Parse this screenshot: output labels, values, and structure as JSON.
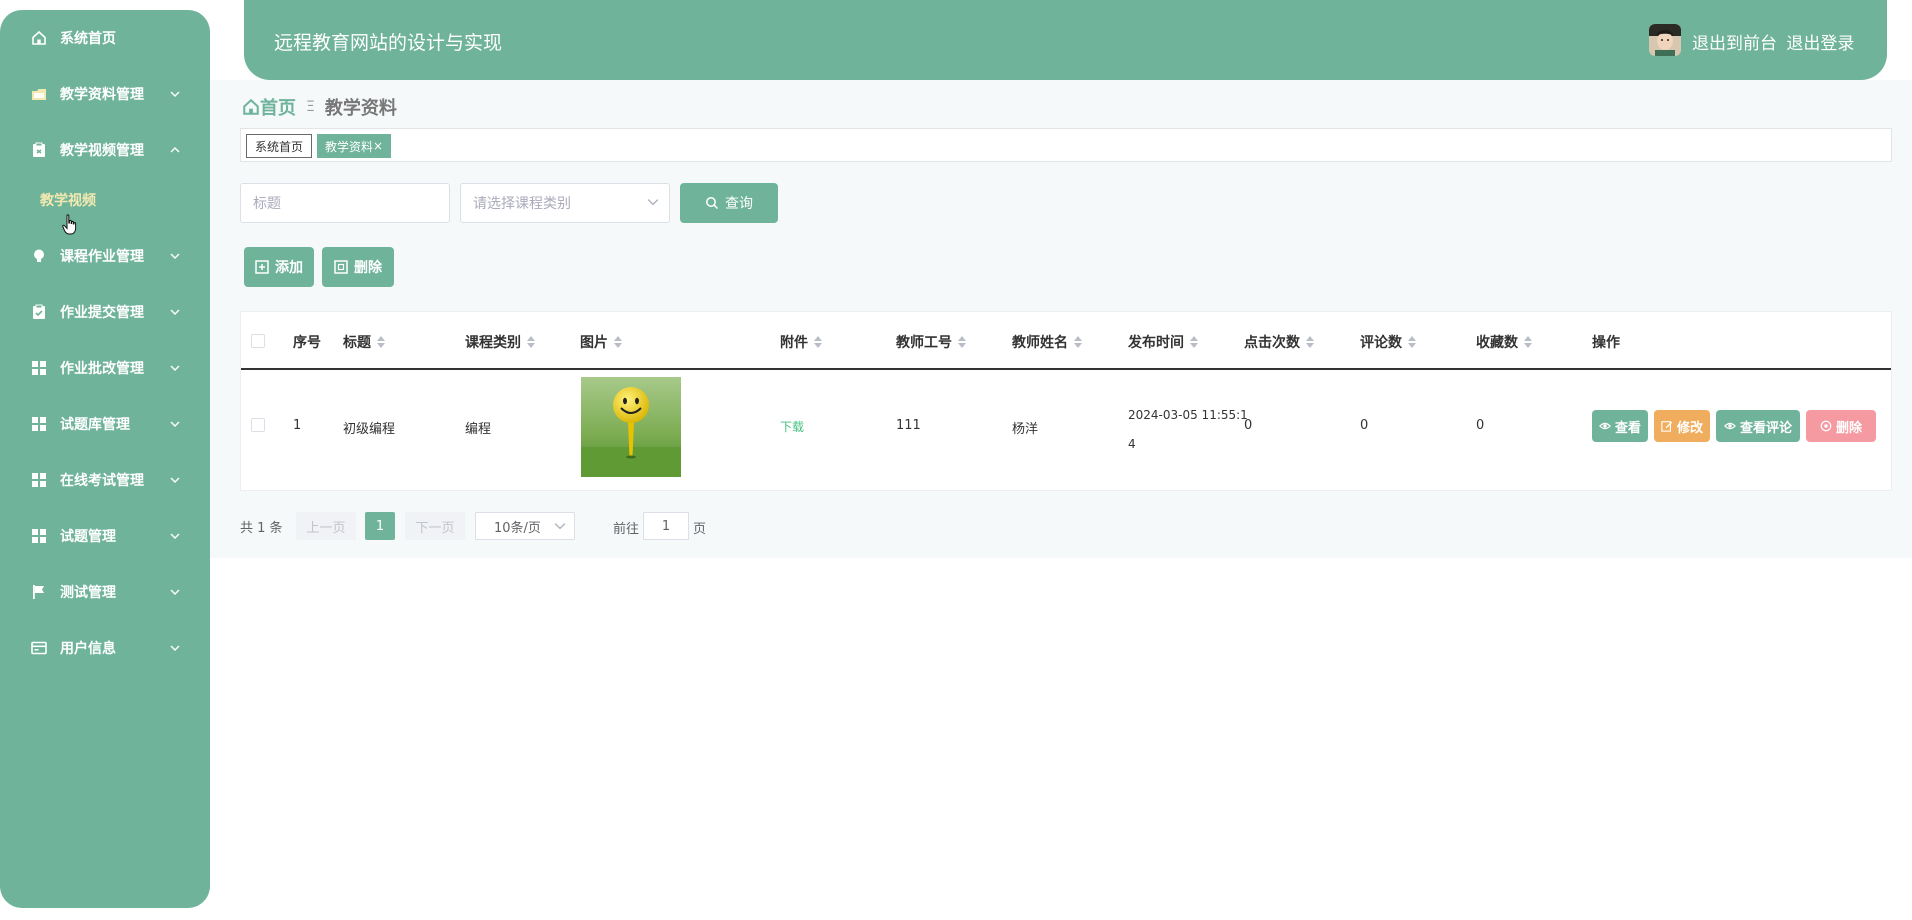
{
  "header": {
    "title": "远程教育网站的设计与实现",
    "link_front": "退出到前台",
    "link_logout": "退出登录"
  },
  "sidebar": {
    "items": [
      {
        "label": "系统首页",
        "icon": "home-icon"
      },
      {
        "label": "教学资料管理",
        "icon": "folder-icon"
      },
      {
        "label": "教学视频管理",
        "icon": "clipboard-icon"
      },
      {
        "label": "课程作业管理",
        "icon": "bulb-icon"
      },
      {
        "label": "作业提交管理",
        "icon": "clipboard-check-icon"
      },
      {
        "label": "作业批改管理",
        "icon": "grid-icon"
      },
      {
        "label": "试题库管理",
        "icon": "grid-icon"
      },
      {
        "label": "在线考试管理",
        "icon": "grid-icon"
      },
      {
        "label": "试题管理",
        "icon": "grid-icon"
      },
      {
        "label": "测试管理",
        "icon": "flag-icon"
      },
      {
        "label": "用户信息",
        "icon": "card-icon"
      }
    ],
    "sub_item": "教学视频"
  },
  "breadcrumb": {
    "home": "首页",
    "current": "教学资料"
  },
  "tags": {
    "tag1": "系统首页",
    "tag2": "教学资料",
    "tag2_close": "×"
  },
  "search": {
    "title_placeholder": "标题",
    "category_placeholder": "请选择课程类别",
    "query_label": "查询"
  },
  "actions": {
    "add_label": "添加",
    "delete_label": "删除"
  },
  "table": {
    "columns": [
      "序号",
      "标题",
      "课程类别",
      "图片",
      "附件",
      "教师工号",
      "教师姓名",
      "发布时间",
      "点击次数",
      "评论数",
      "收藏数",
      "操作"
    ],
    "rows": [
      {
        "index": "1",
        "title": "初级编程",
        "category": "编程",
        "attachment": "下载",
        "teacher_id": "111",
        "teacher_name": "杨洋",
        "publish_time_line1": "2024-03-05 11:55:1",
        "publish_time_line2": "4",
        "clicks": "0",
        "comments": "0",
        "favorites": "0",
        "op_view": "查看",
        "op_edit": "修改",
        "op_view_comments": "查看评论",
        "op_delete": "删除"
      }
    ]
  },
  "pagination": {
    "total": "共 1 条",
    "prev": "上一页",
    "page": "1",
    "next": "下一页",
    "page_size": "10条/页",
    "goto": "前往",
    "goto_value": "1",
    "unit": "页"
  },
  "colors": {
    "primary": "#6fb39b",
    "edit": "#f0ad5e",
    "delete": "#f59aa1",
    "download_link": "#45c17f",
    "submenu_active": "#f3e9b0"
  }
}
